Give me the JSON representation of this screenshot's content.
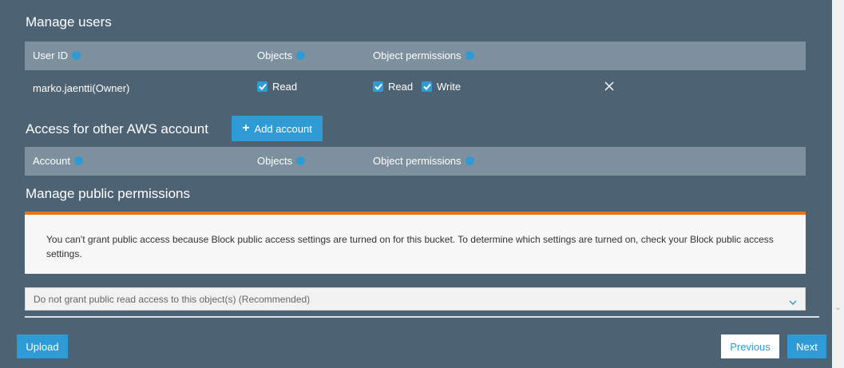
{
  "manage_users": {
    "title": "Manage users",
    "columns": {
      "user_id": "User ID",
      "objects": "Objects",
      "object_permissions": "Object permissions"
    },
    "rows": [
      {
        "user": "marko.jaentti(Owner)",
        "objects_read": "Read",
        "perm_read": "Read",
        "perm_write": "Write"
      }
    ]
  },
  "other_accounts": {
    "title": "Access for other AWS account",
    "add_button": "Add account",
    "columns": {
      "account": "Account",
      "objects": "Objects",
      "object_permissions": "Object permissions"
    }
  },
  "public_permissions": {
    "title": "Manage public permissions",
    "notice": "You can't grant public access because Block public access settings are turned on for this bucket. To determine which settings are turned on, check your Block public access settings.",
    "select_value": "Do not grant public read access to this object(s) (Recommended)"
  },
  "footer": {
    "upload": "Upload",
    "previous": "Previous",
    "next": "Next"
  },
  "colors": {
    "panel": "#4d6272",
    "header": "#7d909e",
    "accent": "#2e9bd6",
    "warning": "#e8751a"
  },
  "icons": [
    "info-icon",
    "checkbox-checked-icon",
    "close-icon",
    "plus-icon",
    "chevron-down-icon"
  ]
}
